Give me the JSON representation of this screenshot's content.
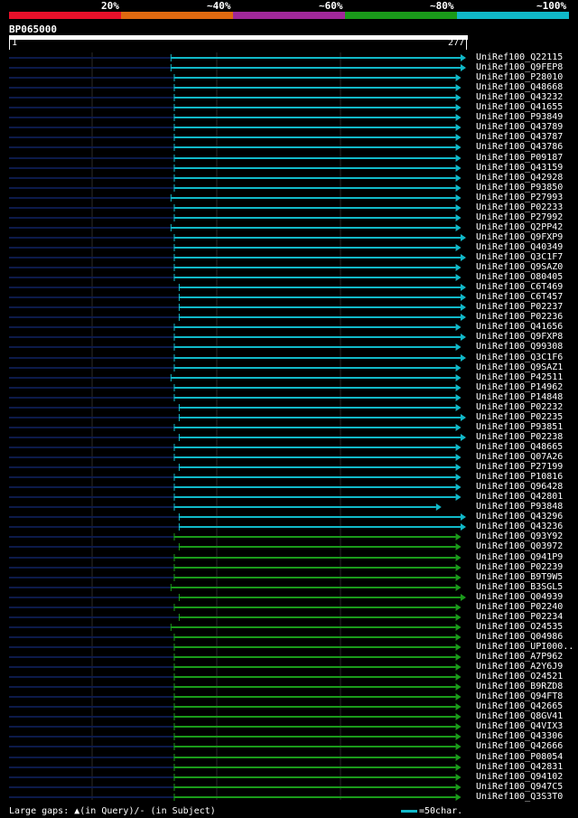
{
  "query": {
    "name": "BP065000",
    "start": "1",
    "end": "277"
  },
  "identity_scale": {
    "labels": [
      "20%",
      "~40%",
      "~60%",
      "~80%",
      "~100%"
    ],
    "colors": [
      "#e8102a",
      "#e06a10",
      "#a0289a",
      "#1a9a1a",
      "#10b8c8"
    ]
  },
  "legend": {
    "gaps_text": "Large gaps: ▲(in Query)/- (in Subject)",
    "scale_text": "=50char."
  },
  "chart_data": {
    "type": "alignment",
    "query_length": 277,
    "hits": [
      {
        "id": "UniRef100_Q22115",
        "start": 100,
        "end": 277,
        "identity": "~100%"
      },
      {
        "id": "UniRef100_Q9FEP8",
        "start": 100,
        "end": 277,
        "identity": "~100%"
      },
      {
        "id": "UniRef100_P28010",
        "start": 102,
        "end": 274,
        "identity": "~100%"
      },
      {
        "id": "UniRef100_Q48668",
        "start": 102,
        "end": 274,
        "identity": "~100%"
      },
      {
        "id": "UniRef100_Q43232",
        "start": 102,
        "end": 274,
        "identity": "~100%"
      },
      {
        "id": "UniRef100_Q41655",
        "start": 102,
        "end": 274,
        "identity": "~100%"
      },
      {
        "id": "UniRef100_P93849",
        "start": 102,
        "end": 274,
        "identity": "~100%"
      },
      {
        "id": "UniRef100_Q43789",
        "start": 102,
        "end": 274,
        "identity": "~100%"
      },
      {
        "id": "UniRef100_Q43787",
        "start": 102,
        "end": 274,
        "identity": "~100%"
      },
      {
        "id": "UniRef100_Q43786",
        "start": 102,
        "end": 274,
        "identity": "~100%"
      },
      {
        "id": "UniRef100_P09187",
        "start": 102,
        "end": 274,
        "identity": "~100%"
      },
      {
        "id": "UniRef100_Q43159",
        "start": 102,
        "end": 274,
        "identity": "~100%"
      },
      {
        "id": "UniRef100_Q42928",
        "start": 102,
        "end": 274,
        "identity": "~100%"
      },
      {
        "id": "UniRef100_P93850",
        "start": 102,
        "end": 274,
        "identity": "~100%"
      },
      {
        "id": "UniRef100_P27993",
        "start": 100,
        "end": 274,
        "identity": "~100%"
      },
      {
        "id": "UniRef100_P02233",
        "start": 102,
        "end": 274,
        "identity": "~100%"
      },
      {
        "id": "UniRef100_P27992",
        "start": 102,
        "end": 274,
        "identity": "~100%"
      },
      {
        "id": "UniRef100_Q2PP42",
        "start": 100,
        "end": 274,
        "identity": "~100%"
      },
      {
        "id": "UniRef100_Q9FXP9",
        "start": 102,
        "end": 277,
        "identity": "~100%"
      },
      {
        "id": "UniRef100_Q40349",
        "start": 102,
        "end": 274,
        "identity": "~100%"
      },
      {
        "id": "UniRef100_Q3C1F7",
        "start": 102,
        "end": 277,
        "identity": "~100%"
      },
      {
        "id": "UniRef100_Q9SAZ0",
        "start": 102,
        "end": 274,
        "identity": "~100%"
      },
      {
        "id": "UniRef100_O80405",
        "start": 102,
        "end": 274,
        "identity": "~100%"
      },
      {
        "id": "UniRef100_C6T469",
        "start": 105,
        "end": 277,
        "identity": "~100%"
      },
      {
        "id": "UniRef100_C6T457",
        "start": 105,
        "end": 277,
        "identity": "~100%"
      },
      {
        "id": "UniRef100_P02237",
        "start": 105,
        "end": 277,
        "identity": "~100%"
      },
      {
        "id": "UniRef100_P02236",
        "start": 105,
        "end": 277,
        "identity": "~100%"
      },
      {
        "id": "UniRef100_Q41656",
        "start": 102,
        "end": 274,
        "identity": "~100%"
      },
      {
        "id": "UniRef100_Q9FXP8",
        "start": 102,
        "end": 277,
        "identity": "~100%"
      },
      {
        "id": "UniRef100_Q99308",
        "start": 102,
        "end": 274,
        "identity": "~100%"
      },
      {
        "id": "UniRef100_Q3C1F6",
        "start": 102,
        "end": 277,
        "identity": "~100%"
      },
      {
        "id": "UniRef100_Q9SAZ1",
        "start": 102,
        "end": 274,
        "identity": "~100%"
      },
      {
        "id": "UniRef100_P42511",
        "start": 100,
        "end": 274,
        "identity": "~100%"
      },
      {
        "id": "UniRef100_P14962",
        "start": 102,
        "end": 274,
        "identity": "~100%"
      },
      {
        "id": "UniRef100_P14848",
        "start": 102,
        "end": 274,
        "identity": "~100%"
      },
      {
        "id": "UniRef100_P02232",
        "start": 105,
        "end": 274,
        "identity": "~100%"
      },
      {
        "id": "UniRef100_P02235",
        "start": 105,
        "end": 277,
        "identity": "~100%"
      },
      {
        "id": "UniRef100_P93851",
        "start": 102,
        "end": 274,
        "identity": "~100%"
      },
      {
        "id": "UniRef100_P02238",
        "start": 105,
        "end": 277,
        "identity": "~100%"
      },
      {
        "id": "UniRef100_Q48665",
        "start": 102,
        "end": 274,
        "identity": "~100%"
      },
      {
        "id": "UniRef100_Q07A26",
        "start": 102,
        "end": 274,
        "identity": "~100%"
      },
      {
        "id": "UniRef100_P27199",
        "start": 105,
        "end": 274,
        "identity": "~100%"
      },
      {
        "id": "UniRef100_P10816",
        "start": 102,
        "end": 274,
        "identity": "~100%"
      },
      {
        "id": "UniRef100_Q96428",
        "start": 102,
        "end": 274,
        "identity": "~100%"
      },
      {
        "id": "UniRef100_Q42801",
        "start": 102,
        "end": 274,
        "identity": "~100%"
      },
      {
        "id": "UniRef100_P93848",
        "start": 102,
        "end": 262,
        "identity": "~100%"
      },
      {
        "id": "UniRef100_Q43296",
        "start": 105,
        "end": 277,
        "identity": "~100%"
      },
      {
        "id": "UniRef100_Q43236",
        "start": 105,
        "end": 277,
        "identity": "~100%"
      },
      {
        "id": "UniRef100_Q93Y92",
        "start": 102,
        "end": 274,
        "identity": "~80%"
      },
      {
        "id": "UniRef100_Q03972",
        "start": 105,
        "end": 274,
        "identity": "~80%"
      },
      {
        "id": "UniRef100_Q941P9",
        "start": 102,
        "end": 274,
        "identity": "~80%"
      },
      {
        "id": "UniRef100_P02239",
        "start": 102,
        "end": 274,
        "identity": "~80%"
      },
      {
        "id": "UniRef100_B9T9W5",
        "start": 102,
        "end": 274,
        "identity": "~80%"
      },
      {
        "id": "UniRef100_B3SGL5",
        "start": 100,
        "end": 274,
        "identity": "~80%"
      },
      {
        "id": "UniRef100_Q04939",
        "start": 105,
        "end": 277,
        "identity": "~80%"
      },
      {
        "id": "UniRef100_P02240",
        "start": 102,
        "end": 274,
        "identity": "~80%"
      },
      {
        "id": "UniRef100_P02234",
        "start": 105,
        "end": 274,
        "identity": "~80%"
      },
      {
        "id": "UniRef100_O24535",
        "start": 100,
        "end": 274,
        "identity": "~80%"
      },
      {
        "id": "UniRef100_Q04986",
        "start": 102,
        "end": 274,
        "identity": "~80%"
      },
      {
        "id": "UniRef100_UPI000..",
        "start": 102,
        "end": 274,
        "identity": "~80%"
      },
      {
        "id": "UniRef100_A7P962",
        "start": 102,
        "end": 274,
        "identity": "~80%"
      },
      {
        "id": "UniRef100_A2Y6J9",
        "start": 102,
        "end": 274,
        "identity": "~80%"
      },
      {
        "id": "UniRef100_O24521",
        "start": 102,
        "end": 274,
        "identity": "~80%"
      },
      {
        "id": "UniRef100_B9RZD8",
        "start": 102,
        "end": 274,
        "identity": "~80%"
      },
      {
        "id": "UniRef100_Q94FT8",
        "start": 102,
        "end": 274,
        "identity": "~80%"
      },
      {
        "id": "UniRef100_Q42665",
        "start": 102,
        "end": 274,
        "identity": "~80%"
      },
      {
        "id": "UniRef100_Q8GV41",
        "start": 102,
        "end": 274,
        "identity": "~80%"
      },
      {
        "id": "UniRef100_Q4VIX3",
        "start": 102,
        "end": 274,
        "identity": "~80%"
      },
      {
        "id": "UniRef100_Q43306",
        "start": 102,
        "end": 274,
        "identity": "~80%"
      },
      {
        "id": "UniRef100_Q42666",
        "start": 102,
        "end": 274,
        "identity": "~80%"
      },
      {
        "id": "UniRef100_P08054",
        "start": 102,
        "end": 274,
        "identity": "~80%"
      },
      {
        "id": "UniRef100_Q42831",
        "start": 102,
        "end": 274,
        "identity": "~80%"
      },
      {
        "id": "UniRef100_Q94102",
        "start": 102,
        "end": 274,
        "identity": "~80%"
      },
      {
        "id": "UniRef100_Q947C5",
        "start": 102,
        "end": 274,
        "identity": "~80%"
      },
      {
        "id": "UniRef100_Q3S3T0",
        "start": 102,
        "end": 274,
        "identity": "~80%"
      }
    ]
  }
}
